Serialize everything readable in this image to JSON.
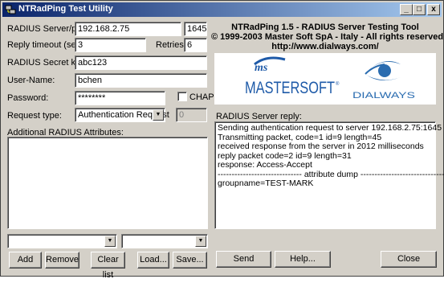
{
  "window": {
    "title": "NTRadPing Test Utility",
    "minimize": "_",
    "maximize": "□",
    "close": "x"
  },
  "form": {
    "server_label": "RADIUS Server/port:",
    "server_value": "192.168.2.75",
    "port_value": "1645",
    "timeout_label": "Reply timeout (sec.):",
    "timeout_value": "3",
    "retries_label": "Retries:",
    "retries_value": "6",
    "secret_label": "RADIUS Secret key:",
    "secret_value": "abc123",
    "username_label": "User-Name:",
    "username_value": "bchen",
    "password_label": "Password:",
    "password_value": "********",
    "chap_label": "CHAP",
    "request_type_label": "Request type:",
    "request_type_value": "Authentication Request",
    "request_id_value": "0",
    "attributes_label": "Additional RADIUS Attributes:"
  },
  "buttons": {
    "add": "Add",
    "remove": "Remove",
    "clear": "Clear list",
    "load": "Load...",
    "save": "Save...",
    "send": "Send",
    "help": "Help...",
    "close": "Close"
  },
  "header": {
    "line1": "NTRadPing 1.5 - RADIUS Server Testing Tool",
    "line2": "© 1999-2003 Master Soft SpA - Italy - All rights reserved",
    "line3": "http://www.dialways.com/"
  },
  "logos": {
    "mastersoft_ms": "ms",
    "mastersoft_name": "MASTERSOFT",
    "registered": "®",
    "dialways_name": "DIALWAYS"
  },
  "reply": {
    "label": "RADIUS Server reply:",
    "lines": [
      "Sending authentication request to server 192.168.2.75:1645",
      "Transmitting packet, code=1 id=9 length=45",
      "received response from the server in 2012 milliseconds",
      "reply packet code=2 id=9 length=31",
      "response: Access-Accept",
      "------------------------------ attribute dump ------------------------------",
      "groupname=TEST-MARK"
    ]
  },
  "colors": {
    "titlebar_start": "#0a246a",
    "titlebar_end": "#a6caf0",
    "face": "#d4d0c8",
    "mastersoft_blue": "#1e5aa8",
    "dialways_blue": "#2a6cb0"
  },
  "icons": {
    "title_icon": "network-icon",
    "dropdown": "chevron-down-icon"
  }
}
